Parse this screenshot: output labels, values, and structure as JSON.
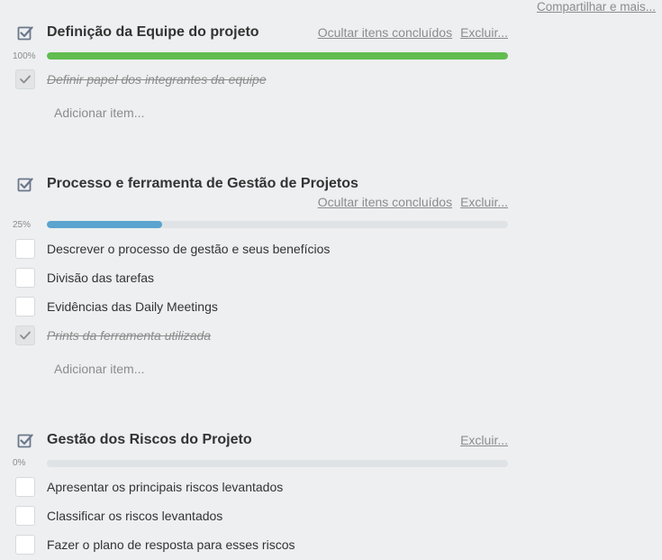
{
  "header": {
    "share_label": "Compartilhar e mais..."
  },
  "colors": {
    "complete_bar": "#61bd4f",
    "progress_bar": "#5ba4cf",
    "track": "#dfe3e6"
  },
  "checklists": [
    {
      "title": "Definição da Equipe do projeto",
      "hide_label": "Ocultar itens concluídos",
      "delete_label": "Excluir...",
      "percent_label": "100%",
      "progress": 1.0,
      "items": [
        {
          "text": "Definir papel dos integrantes da equipe",
          "checked": true
        }
      ],
      "add_label": "Adicionar item..."
    },
    {
      "title": "Processo e ferramenta de Gestão de Projetos",
      "hide_label": "Ocultar itens concluídos",
      "delete_label": "Excluir...",
      "percent_label": "25%",
      "progress": 0.25,
      "items": [
        {
          "text": "Descrever o processo de gestão e seus benefícios",
          "checked": false
        },
        {
          "text": "Divisão das tarefas",
          "checked": false
        },
        {
          "text": "Evidências das Daily Meetings",
          "checked": false
        },
        {
          "text": "Prints da ferramenta utilizada",
          "checked": true
        }
      ],
      "add_label": "Adicionar item..."
    },
    {
      "title": "Gestão dos Riscos do Projeto",
      "delete_label": "Excluir...",
      "percent_label": "0%",
      "progress": 0.0,
      "items": [
        {
          "text": "Apresentar os principais riscos levantados",
          "checked": false
        },
        {
          "text": "Classificar os riscos levantados",
          "checked": false
        },
        {
          "text": "Fazer o plano de resposta para esses riscos",
          "checked": false
        }
      ]
    }
  ]
}
